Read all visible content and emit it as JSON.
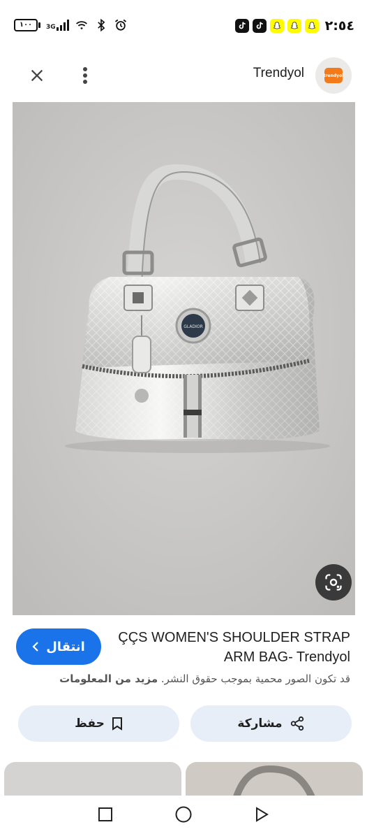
{
  "status_bar": {
    "time": "٢:٥٤",
    "battery": "١٠٠",
    "network": "3G",
    "icons": [
      "battery-icon",
      "signal-icon",
      "wifi-icon",
      "bluetooth-icon",
      "alarm-icon",
      "tiktok-icon",
      "tiktok-icon",
      "snapchat-icon",
      "snapchat-icon",
      "snapchat-icon"
    ]
  },
  "top_bar": {
    "site_name": "Trendyol",
    "logo_text": "trendyol"
  },
  "product": {
    "title": "ÇÇS WOMEN'S SHOULDER STRAP ARM BAG- Trendyol",
    "visit_label": "انتقال",
    "copyright_text": "قد تكون الصور محمية بموجب حقوق النشر.",
    "more_info": "مزيد من المعلومات",
    "badge_text": "GLADIOR"
  },
  "actions": {
    "save_label": "حفظ",
    "share_label": "مشاركة"
  },
  "colors": {
    "accent": "#1a73e8",
    "action_bg": "#e8eef8",
    "brand_orange": "#f27a1a"
  }
}
